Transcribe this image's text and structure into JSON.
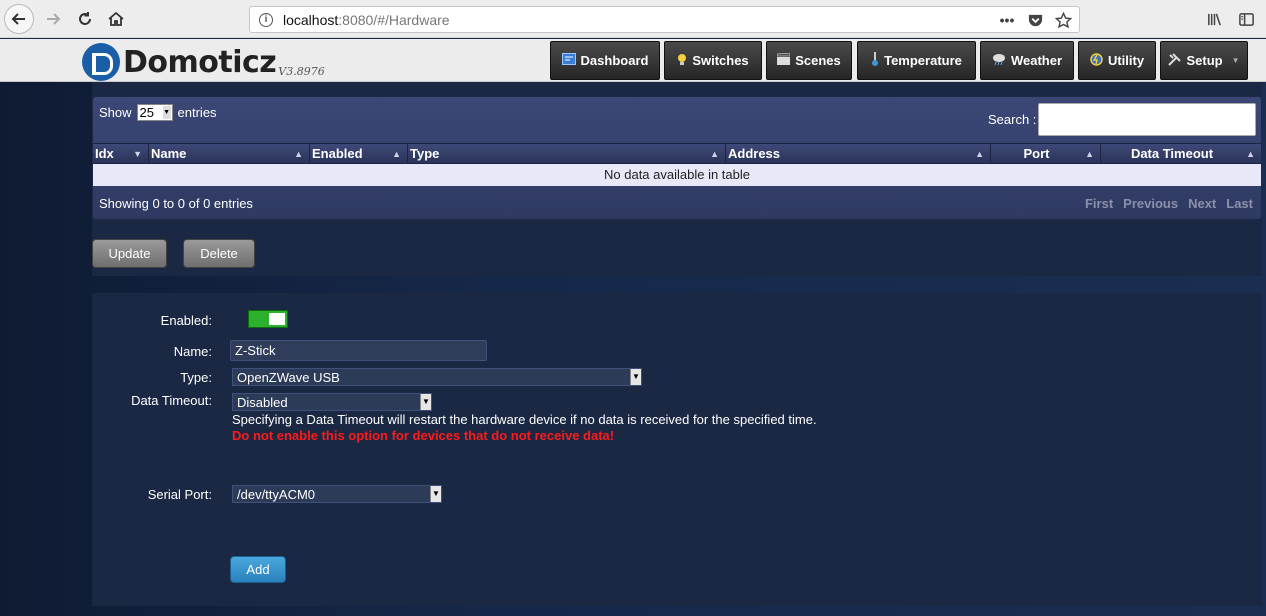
{
  "browser": {
    "url_host": "localhost",
    "url_rest": ":8080/#/Hardware",
    "dots": "•••"
  },
  "app": {
    "logo_text": "Domoticz",
    "version": "V3.8976"
  },
  "nav": [
    {
      "label": "Dashboard",
      "icon": "dashboard-icon"
    },
    {
      "label": "Switches",
      "icon": "lightbulb-icon"
    },
    {
      "label": "Scenes",
      "icon": "clapper-icon"
    },
    {
      "label": "Temperature",
      "icon": "thermometer-icon"
    },
    {
      "label": "Weather",
      "icon": "cloud-rain-icon"
    },
    {
      "label": "Utility",
      "icon": "utility-icon"
    },
    {
      "label": "Setup",
      "icon": "tools-icon"
    }
  ],
  "table": {
    "show_label": "Show",
    "entries_value": "25",
    "entries_label": "entries",
    "search_label": "Search :",
    "search_value": "",
    "columns": [
      "Idx",
      "Name",
      "Enabled",
      "Type",
      "Address",
      "Port",
      "Data Timeout"
    ],
    "empty_text": "No data available in table",
    "info_text": "Showing 0 to 0 of 0 entries",
    "paging": [
      "First",
      "Previous",
      "Next",
      "Last"
    ]
  },
  "buttons": {
    "update": "Update",
    "delete": "Delete",
    "add": "Add"
  },
  "form": {
    "enabled_label": "Enabled:",
    "enabled": true,
    "name_label": "Name:",
    "name_value": "Z-Stick",
    "type_label": "Type:",
    "type_value": "OpenZWave USB",
    "timeout_label": "Data Timeout:",
    "timeout_value": "Disabled",
    "timeout_help": "Specifying a Data Timeout will restart the hardware device if no data is received for the specified time.",
    "timeout_warning": "Do not enable this option for devices that do not receive data!",
    "serial_label": "Serial Port:",
    "serial_value": "/dev/ttyACM0"
  },
  "colors": {
    "toggle_on": "#2bb12b",
    "warning": "#ff1a1a",
    "add_button": "#2b81bd"
  }
}
